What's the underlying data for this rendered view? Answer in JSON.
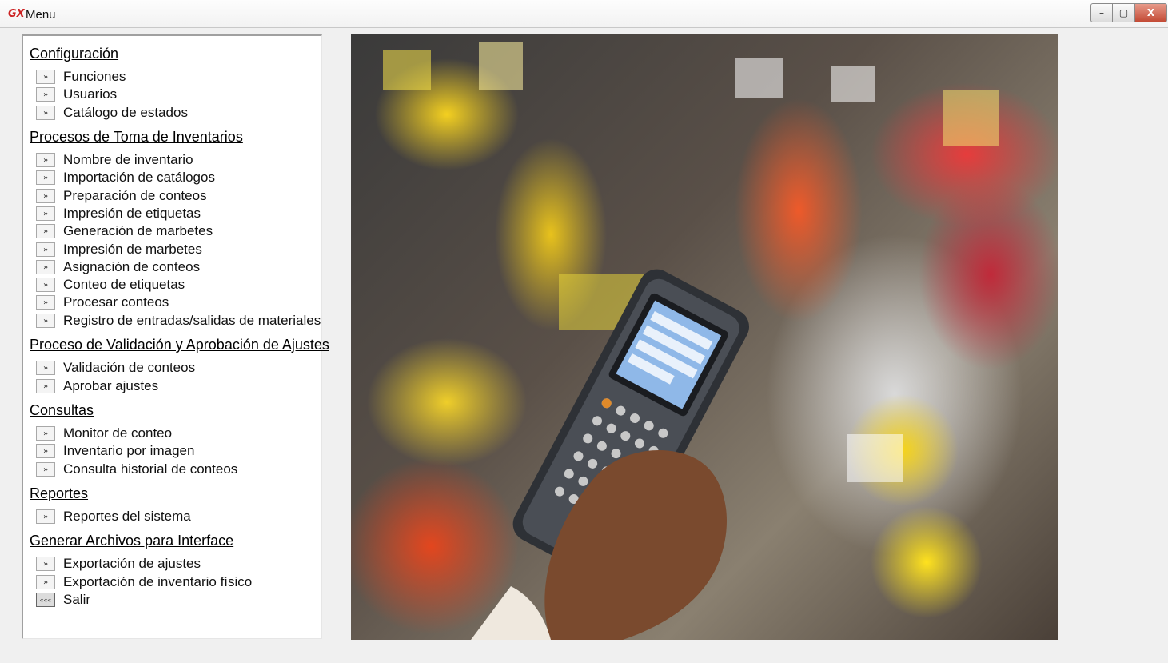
{
  "window": {
    "logo": "GX",
    "title": "Menu",
    "controls": {
      "minimize": "–",
      "restore": "▢",
      "close": "X"
    }
  },
  "menu": {
    "item_arrow": "»",
    "exit_arrow": "«««",
    "sections": [
      {
        "title": "Configuración",
        "items": [
          "Funciones",
          "Usuarios",
          "Catálogo de estados"
        ]
      },
      {
        "title": "Procesos de Toma de Inventarios",
        "items": [
          "Nombre de inventario",
          "Importación de catálogos",
          "Preparación de conteos",
          "Impresión de etiquetas",
          "Generación de marbetes",
          "Impresión de marbetes",
          "Asignación de conteos",
          "Conteo de etiquetas",
          "Procesar conteos",
          "Registro de entradas/salidas de materiales"
        ]
      },
      {
        "title": "Proceso de Validación y Aprobación de Ajustes",
        "items": [
          "Validación de conteos",
          "Aprobar ajustes"
        ]
      },
      {
        "title": "Consultas",
        "items": [
          "Monitor de conteo",
          "Inventario por imagen",
          "Consulta historial de conteos"
        ]
      },
      {
        "title": "Reportes",
        "items": [
          "Reportes del sistema"
        ]
      },
      {
        "title": "Generar Archivos para Interface",
        "items": [
          "Exportación de ajustes",
          "Exportación de inventario físico"
        ]
      }
    ],
    "exit_label": "Salir"
  },
  "photo": {
    "subject": "handheld-barcode-scanner-in-store"
  },
  "colors": {
    "title_logo": "#cc2222",
    "close_button": "#c34a35",
    "link_text": "#000000"
  }
}
